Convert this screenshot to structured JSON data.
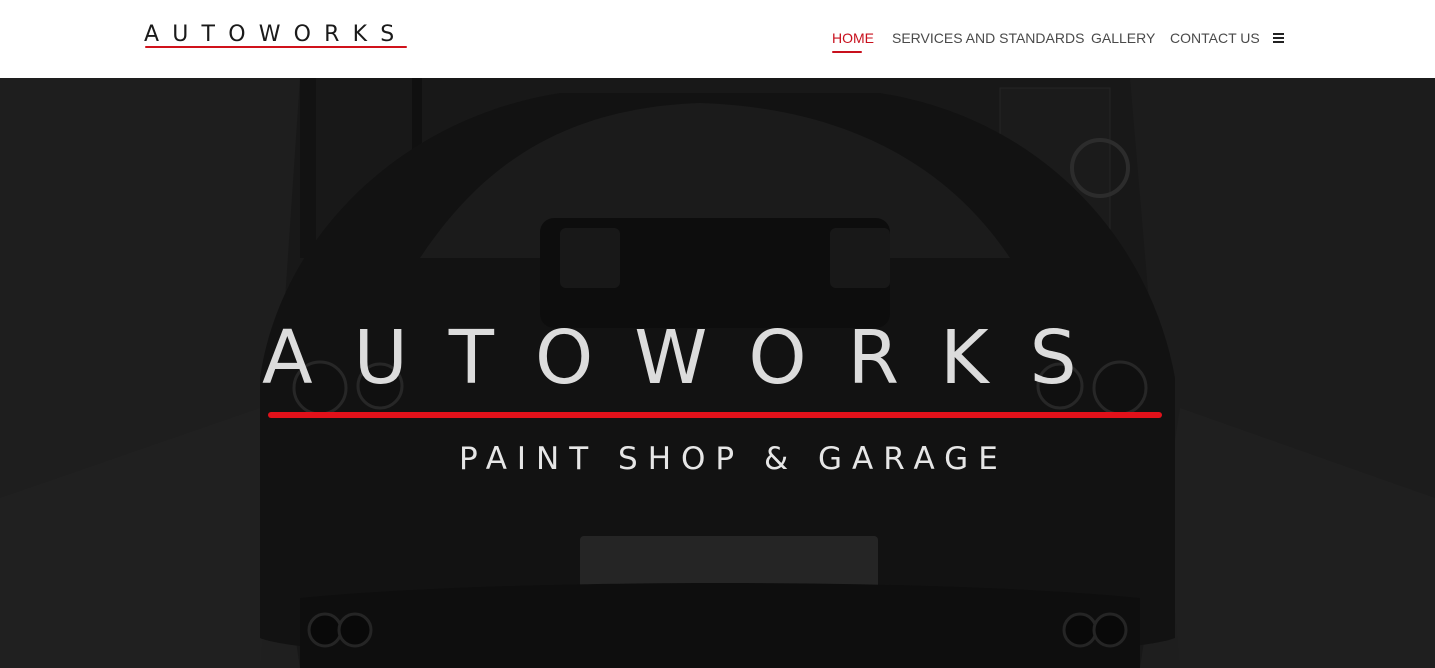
{
  "header": {
    "logo_text": "AUTOWORKS",
    "nav": [
      {
        "label": "HOME",
        "active": true
      },
      {
        "label": "SERVICES AND STANDARDS",
        "active": false
      },
      {
        "label": "GALLERY",
        "active": false
      },
      {
        "label": "CONTACT US",
        "active": false
      }
    ],
    "menu_icon": "hamburger-icon"
  },
  "hero": {
    "title": "AUTOWORKS",
    "subtitle": "PAINT SHOP & GARAGE",
    "background": "car-photo"
  },
  "colors": {
    "accent": "#d0121b",
    "nav_text": "#4a4a4a",
    "header_bg": "#ffffff"
  }
}
